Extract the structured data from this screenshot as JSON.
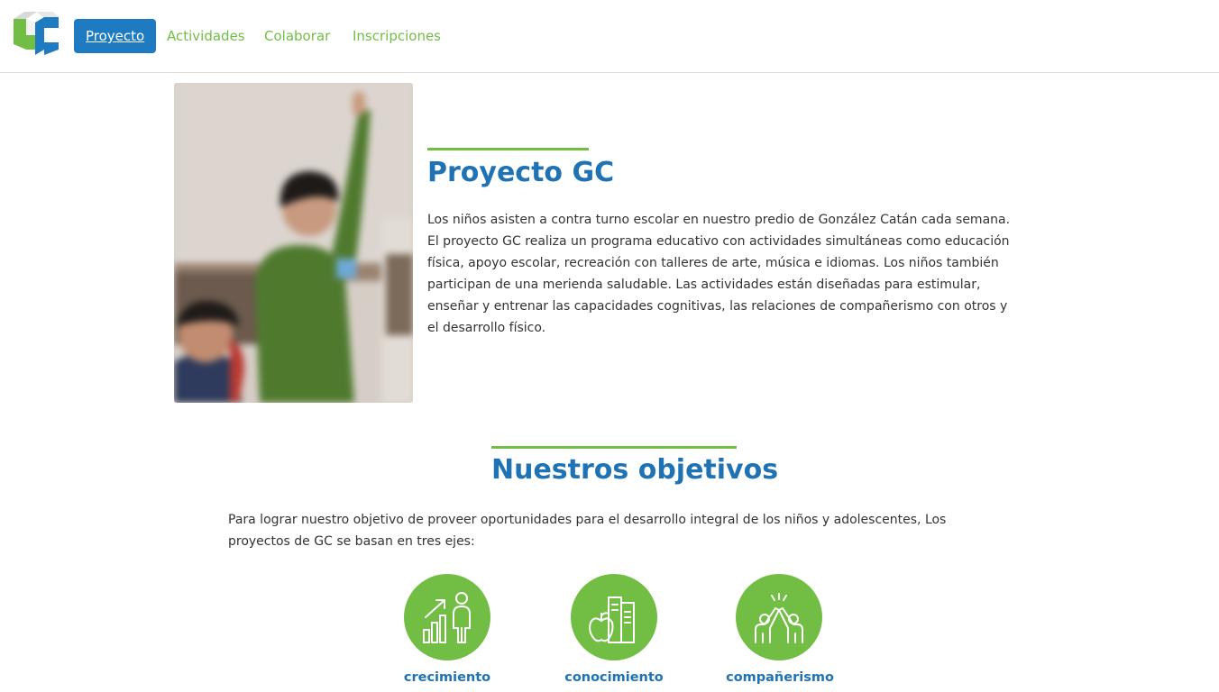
{
  "nav": {
    "items": [
      {
        "label": "Proyecto",
        "active": true
      },
      {
        "label": "Actividades",
        "active": false
      },
      {
        "label": "Colaborar",
        "active": false
      },
      {
        "label": "Inscripciones",
        "active": false
      }
    ]
  },
  "project": {
    "title": "Proyecto GC",
    "description": "Los niños asisten a contra turno escolar en nuestro predio de González Catán cada semana. El proyecto GC realiza un programa educativo con actividades simultáneas como educación física, apoyo escolar, recreación con talleres de arte, música e idiomas. Los niños también participan de una merienda saludable. Las actividades están diseñadas para estimular, enseñar y entrenar las capacidades cognitivas, las relaciones de compañerismo con otros y el desarrollo físico."
  },
  "objectives": {
    "title": "Nuestros objetivos",
    "intro": "Para lograr nuestro objetivo de proveer oportunidades para el desarrollo integral de los niños y adolescentes, Los proyectos de GC se basan en tres ejes:",
    "axes": [
      {
        "label": "crecimiento",
        "icon": "growth-chart-person-icon"
      },
      {
        "label": "conocimiento",
        "icon": "apple-books-icon"
      },
      {
        "label": "compañerismo",
        "icon": "high-five-icon"
      }
    ]
  },
  "colors": {
    "brand_blue": "#1f7bc1",
    "brand_green": "#72be44",
    "heading_blue": "#1f73b5"
  }
}
